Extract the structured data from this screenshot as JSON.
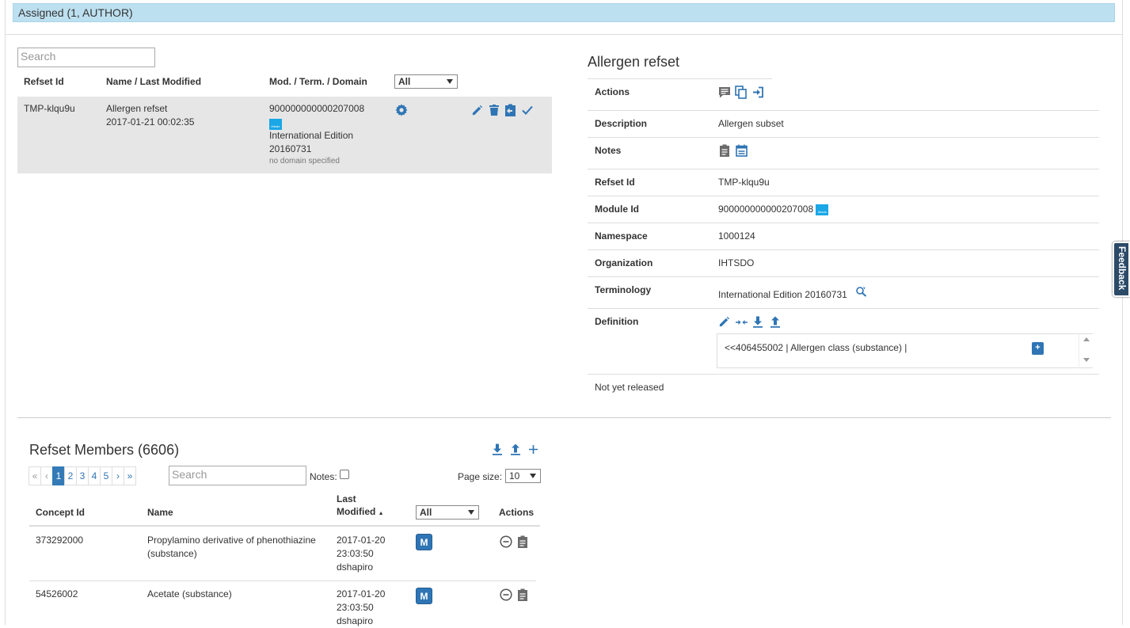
{
  "assigned": "Assigned (1, AUTHOR)",
  "refset_list": {
    "search_placeholder": "Search",
    "columns": {
      "refset_id": "Refset Id",
      "name": "Name / Last Modified",
      "module": "Mod. / Term. / Domain",
      "filter": "All"
    },
    "row": {
      "refset_id": "TMP-klqu9u",
      "name": "Allergen refset",
      "last_modified": "2017-01-21 00:02:35",
      "module_id": "900000000000207008",
      "logo_text": "ihtsdo",
      "edition": "International Edition",
      "version": "20160731",
      "domain": "no domain specified"
    }
  },
  "detail": {
    "title": "Allergen refset",
    "labels": {
      "actions": "Actions",
      "description": "Description",
      "notes": "Notes",
      "refset_id": "Refset Id",
      "module_id": "Module Id",
      "namespace": "Namespace",
      "organization": "Organization",
      "terminology": "Terminology",
      "definition": "Definition"
    },
    "values": {
      "description": "Allergen subset",
      "refset_id": "TMP-klqu9u",
      "module_id": "900000000000207008",
      "namespace": "1000124",
      "organization": "IHTSDO",
      "terminology": "International Edition 20160731",
      "definition": "<<406455002 | Allergen class (substance) |"
    },
    "definition_add": "+",
    "release_status": "Not yet released"
  },
  "members": {
    "title": "Refset Members (6606)",
    "pager": [
      "«",
      "‹",
      "1",
      "2",
      "3",
      "4",
      "5",
      "›",
      "»"
    ],
    "active_page": "1",
    "search_placeholder": "Search",
    "notes_label": "Notes:",
    "page_size_label": "Page size:",
    "page_size": "10",
    "columns": {
      "concept_id": "Concept Id",
      "name": "Name",
      "last_modified_1": "Last",
      "last_modified_2": "Modified",
      "sort_indicator": "▲",
      "filter": "All",
      "actions": "Actions"
    },
    "rows": [
      {
        "concept_id": "373292000",
        "name_1": "Propylamino derivative of phenothiazine",
        "name_2": "(substance)",
        "date": "2017-01-20",
        "time": "23:03:50",
        "user": "dshapiro",
        "badge": "M"
      },
      {
        "concept_id": "54526002",
        "name_1": "Acetate (substance)",
        "name_2": "",
        "date": "2017-01-20",
        "time": "23:03:50",
        "user": "dshapiro",
        "badge": "M"
      }
    ]
  },
  "feedback": "Feedback",
  "icons": {
    "refset_row": [
      "gear-icon",
      "pencil-icon",
      "trash-icon",
      "clipboard-arrow-icon",
      "check-icon"
    ],
    "detail_actions": [
      "comment-list-icon",
      "copy-icon",
      "sign-in-icon"
    ],
    "detail_notes": [
      "clipboard-icon",
      "calendar-icon"
    ],
    "terminology": "search-refresh-icon",
    "definition": [
      "pencil-icon",
      "resize-icon",
      "download-icon",
      "upload-icon"
    ],
    "members_toolbar": [
      "download-icon",
      "upload-icon",
      "plus-icon"
    ],
    "member_actions": [
      "minus-circle-icon",
      "clipboard-icon"
    ]
  },
  "colors": {
    "accent": "#2f75b5",
    "assigned_bar": "#bde0f0",
    "selected_row": "#e6e6e6",
    "feedback": "#2c4b68",
    "logo": "#1aa7e6"
  }
}
